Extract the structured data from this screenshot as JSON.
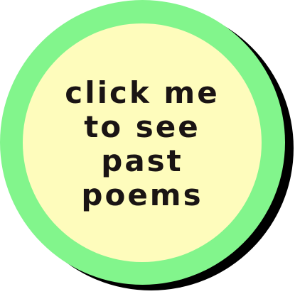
{
  "button": {
    "lines": [
      "click me",
      "to see",
      "past",
      "poems"
    ]
  },
  "colors": {
    "ring": "#82f58c",
    "face": "#fefcbc",
    "shadow": "#000000",
    "text": "#1a1414"
  }
}
